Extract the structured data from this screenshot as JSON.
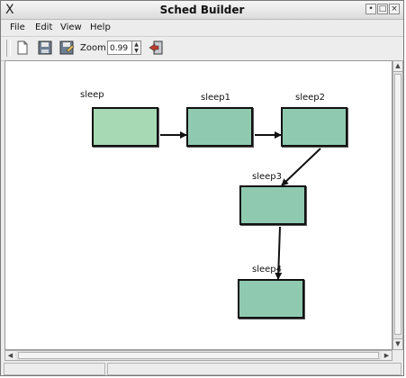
{
  "window": {
    "title": "Sched Builder",
    "title_icon": "X",
    "buttons": [
      "•",
      "□",
      "×"
    ]
  },
  "menu": [
    {
      "label": "File"
    },
    {
      "label": "Edit"
    },
    {
      "label": "View"
    },
    {
      "label": "Help"
    }
  ],
  "toolbar": {
    "zoom_label": "Zoom",
    "zoom_value": "0.99",
    "buttons": [
      "new-file-icon",
      "save-icon",
      "save-as-icon",
      "export-icon"
    ]
  },
  "graph": {
    "nodes": [
      {
        "id": "sleep",
        "label": "sleep"
      },
      {
        "id": "sleep1",
        "label": "sleep1"
      },
      {
        "id": "sleep2",
        "label": "sleep2"
      },
      {
        "id": "sleep3",
        "label": "sleep3"
      },
      {
        "id": "sleep4",
        "label": "sleep4"
      }
    ],
    "edges": [
      [
        "sleep",
        "sleep1"
      ],
      [
        "sleep1",
        "sleep2"
      ],
      [
        "sleep2",
        "sleep3"
      ],
      [
        "sleep3",
        "sleep4"
      ]
    ],
    "node_color": "#8fcab0",
    "first_node_color": "#a6d9b4"
  }
}
